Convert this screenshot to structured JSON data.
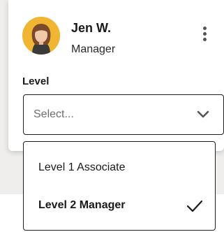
{
  "user": {
    "name": "Jen W.",
    "role": "Manager"
  },
  "field": {
    "label": "Level",
    "placeholder": "Select..."
  },
  "options": [
    {
      "label": "Level 1 Associate",
      "selected": false
    },
    {
      "label": "Level 2 Manager",
      "selected": true
    }
  ],
  "icons": {
    "menu": "more-vertical-icon",
    "chevron": "chevron-down-icon",
    "check": "check-icon"
  },
  "colors": {
    "backdrop": "#efeeec",
    "avatar_bg": "#f0b533",
    "border": "#1f1f1f",
    "placeholder": "#6e6e6e"
  }
}
